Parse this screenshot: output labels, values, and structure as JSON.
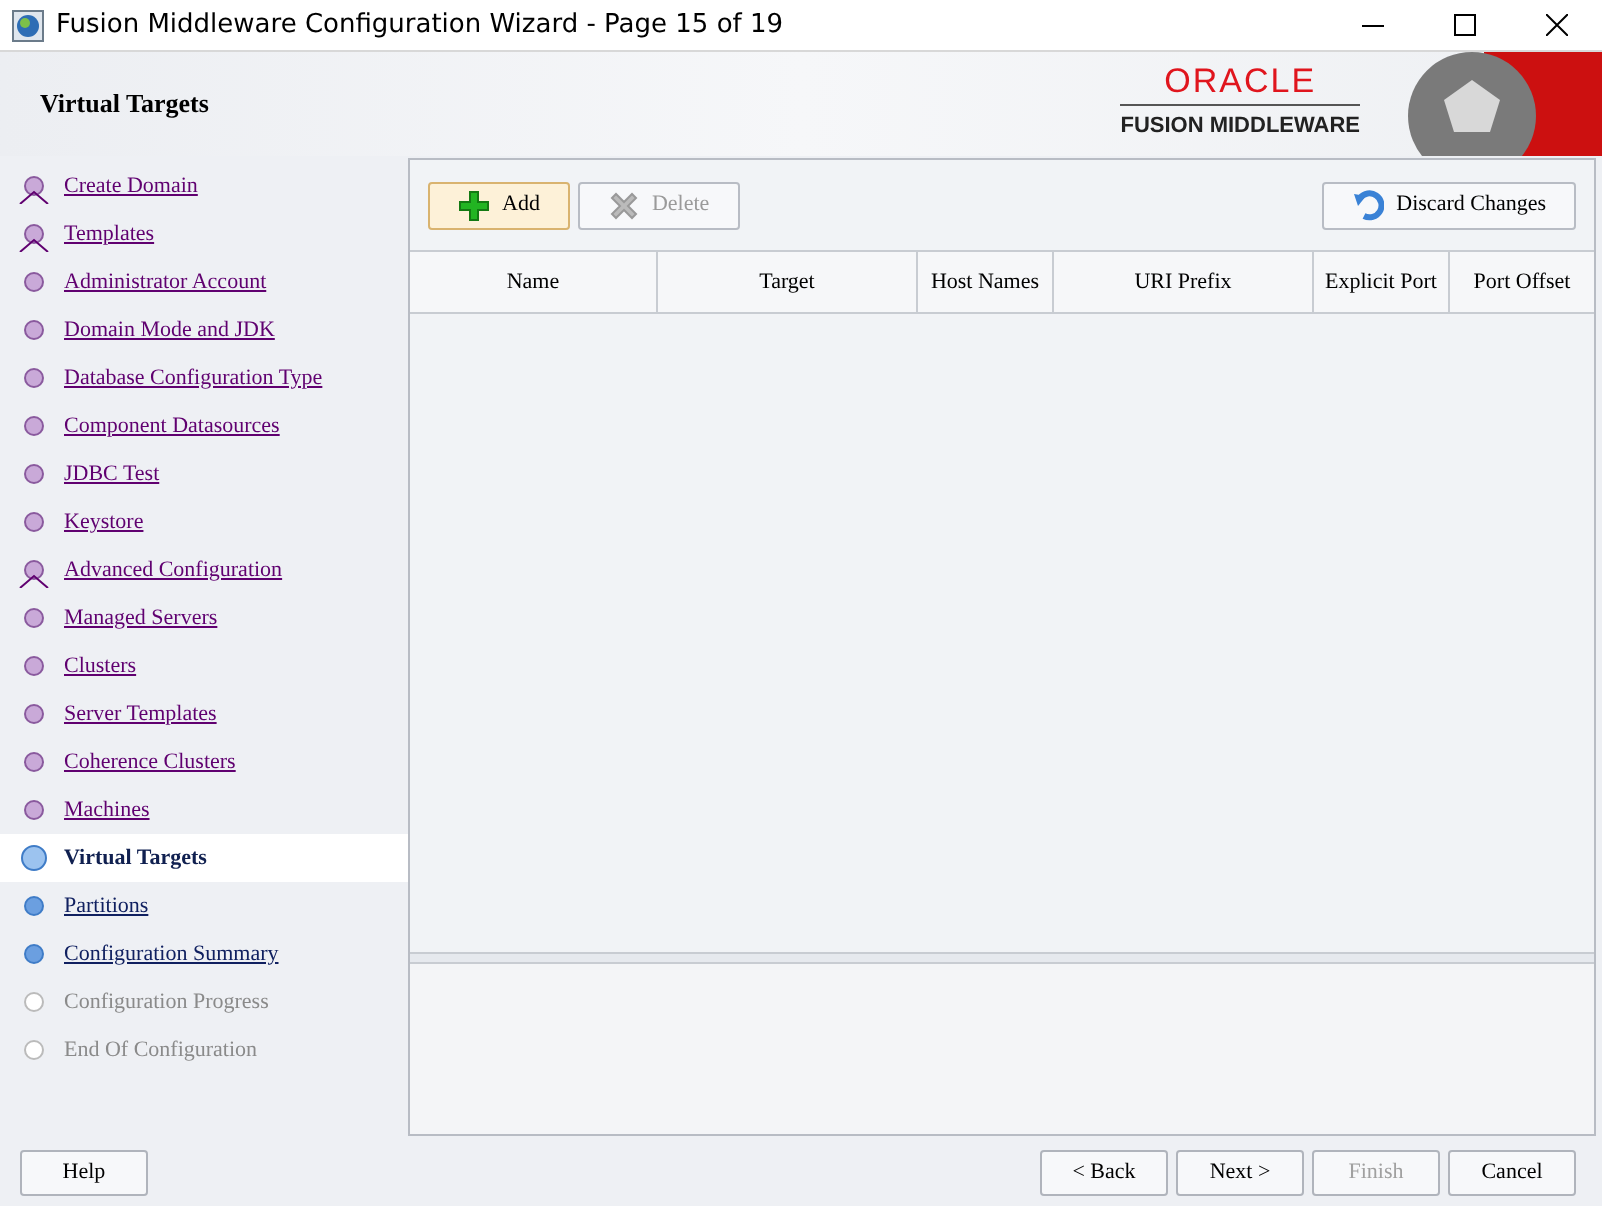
{
  "window": {
    "title": "Fusion Middleware Configuration Wizard - Page 15 of 19"
  },
  "header": {
    "page_title": "Virtual Targets",
    "brand": "ORACLE",
    "product": "FUSION MIDDLEWARE"
  },
  "steps": [
    {
      "label": "Create Domain",
      "kind": "visited",
      "branch": true,
      "selected": false
    },
    {
      "label": "Templates",
      "kind": "visited",
      "branch": true,
      "selected": false
    },
    {
      "label": "Administrator Account",
      "kind": "visited",
      "branch": false,
      "selected": false
    },
    {
      "label": "Domain Mode and JDK",
      "kind": "visited",
      "branch": false,
      "selected": false
    },
    {
      "label": "Database Configuration Type",
      "kind": "visited",
      "branch": false,
      "selected": false
    },
    {
      "label": "Component Datasources",
      "kind": "visited",
      "branch": false,
      "selected": false
    },
    {
      "label": "JDBC Test",
      "kind": "visited",
      "branch": false,
      "selected": false
    },
    {
      "label": "Keystore",
      "kind": "visited",
      "branch": false,
      "selected": false
    },
    {
      "label": "Advanced Configuration",
      "kind": "visited",
      "branch": true,
      "selected": false
    },
    {
      "label": "Managed Servers",
      "kind": "visited",
      "branch": false,
      "selected": false
    },
    {
      "label": "Clusters",
      "kind": "visited",
      "branch": false,
      "selected": false
    },
    {
      "label": "Server Templates",
      "kind": "visited",
      "branch": false,
      "selected": false
    },
    {
      "label": "Coherence Clusters",
      "kind": "visited",
      "branch": false,
      "selected": false
    },
    {
      "label": "Machines",
      "kind": "visited",
      "branch": false,
      "selected": false
    },
    {
      "label": "Virtual Targets",
      "kind": "current",
      "branch": false,
      "selected": true
    },
    {
      "label": "Partitions",
      "kind": "next",
      "branch": false,
      "selected": false
    },
    {
      "label": "Configuration Summary",
      "kind": "next",
      "branch": false,
      "selected": false
    },
    {
      "label": "Configuration Progress",
      "kind": "disabled",
      "branch": false,
      "selected": false
    },
    {
      "label": "End Of Configuration",
      "kind": "disabled",
      "branch": false,
      "selected": false
    }
  ],
  "toolbar": [
    {
      "label": "Add",
      "kind": "add",
      "disabled": false
    },
    {
      "label": "Delete",
      "kind": "delete",
      "disabled": true
    },
    {
      "label": "Discard Changes",
      "kind": "discard",
      "disabled": false
    }
  ],
  "table": {
    "columns": [
      "Name",
      "Target",
      "Host Names",
      "URI Prefix",
      "Explicit Port",
      "Port Offset"
    ]
  },
  "footer": {
    "help": "Help",
    "buttons": [
      {
        "label": "< Back",
        "disabled": false
      },
      {
        "label": "Next >",
        "disabled": false
      },
      {
        "label": "Finish",
        "disabled": true
      },
      {
        "label": "Cancel",
        "disabled": false
      }
    ]
  }
}
